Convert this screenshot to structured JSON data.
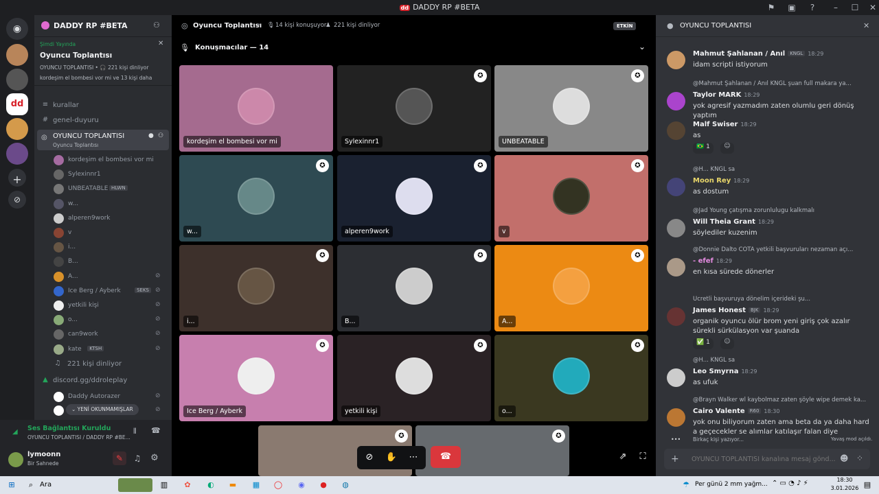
{
  "window": {
    "title": "DADDY RP #BETA"
  },
  "server": {
    "name": "DADDY RP #BETA"
  },
  "live_card": {
    "status": "Şimdi Yayında",
    "title": "Oyuncu Toplantısı",
    "sub": "OYUNCU TOPLANTISI • 🎧 221 kişi dinliyor",
    "people": "kordeşim el bombesi vor mi ve 13 kişi daha"
  },
  "channels": [
    {
      "icon": "≡",
      "label": "kurallar"
    },
    {
      "icon": "#",
      "label": "genel-duyuru"
    }
  ],
  "active_channel": {
    "label": "OYUNCU TOPLANTISI",
    "sub": "Oyuncu Toplantısı"
  },
  "members": [
    {
      "name": "kordeşim el bombesi vor mi",
      "color": "#a56ba1"
    },
    {
      "name": "Sylexinnr1",
      "color": "#666"
    },
    {
      "name": "UNBEATABLE",
      "badge": "HLWN",
      "color": "#777"
    },
    {
      "name": "w...",
      "color": "#556"
    },
    {
      "name": "alperen9work",
      "color": "#ccc"
    },
    {
      "name": "v",
      "color": "#843"
    },
    {
      "name": "i...",
      "color": "#654"
    },
    {
      "name": "B...",
      "color": "#444"
    },
    {
      "name": "A...",
      "color": "#d8912a",
      "muted": true
    },
    {
      "name": "Ice Berg / Ayberk",
      "badge": "SEKS",
      "color": "#36c",
      "muted": true
    },
    {
      "name": "yetkili kişi",
      "color": "#eee",
      "muted": true
    },
    {
      "name": "o...",
      "color": "#8a7",
      "muted": true
    },
    {
      "name": "can9work",
      "color": "#666",
      "muted": true
    },
    {
      "name": "kate",
      "badge": "KTSH",
      "color": "#9a8",
      "muted": true
    }
  ],
  "listening": "221 kişi dinliyor",
  "invite_channel": "discord.gg/ddroleplay",
  "bottom_members": [
    {
      "name": "Daddy Autorazer"
    },
    {
      "name": ""
    }
  ],
  "unread_pill": "YENİ OKUNMAMIŞLAR",
  "voice_status": {
    "title": "Ses Bağlantısı Kuruldu",
    "sub": "OYUNCU TOPLANTISI / DADDY RP #BE..."
  },
  "user": {
    "name": "lymoonn",
    "status": "Bir Sahnede"
  },
  "stage": {
    "title": "Oyuncu Toplantısı",
    "speaking": "14 kişi konuşuyor",
    "listening": "221 kişi dinliyor",
    "live_badge": "ETKİN",
    "speakers_header": "Konuşmacılar — 14"
  },
  "tiles": [
    {
      "label": "kordeşim el bombesi vor mi",
      "bg": "#a56b8f",
      "av": "#c8a"
    },
    {
      "label": "Sylexinnr1",
      "bg": "#222",
      "av": "#555"
    },
    {
      "label": "UNBEATABLE",
      "bg": "#888",
      "av": "#ddd"
    },
    {
      "label": "w...",
      "bg": "#2e4a52",
      "av": "#688"
    },
    {
      "label": "alperen9work",
      "bg": "#1a2130",
      "av": "#dde"
    },
    {
      "label": "v",
      "bg": "#c26f6b",
      "av": "#332"
    },
    {
      "label": "i...",
      "bg": "#3d302b",
      "av": "#654"
    },
    {
      "label": "B...",
      "bg": "#2c2e33",
      "av": "#ccc"
    },
    {
      "label": "A...",
      "bg": "#ec8a13",
      "av": "#f4a040"
    },
    {
      "label": "Ice Berg / Ayberk",
      "bg": "#c77fae",
      "av": "#eee"
    },
    {
      "label": "yetkili kişi",
      "bg": "#2a2225",
      "av": "#ddd"
    },
    {
      "label": "o...",
      "bg": "#3a3820",
      "av": "#2ab"
    }
  ],
  "chat": {
    "header": "OYUNCU TOPLANTISI",
    "messages": [
      {
        "name": "Mahmut Şahlanan / Anıl",
        "tag": "KNGL",
        "time": "18:29",
        "text": "idam scripti istiyorum",
        "color": "#f2f3f5",
        "av": "#c96"
      },
      {
        "reply": "@Mahmut Şahlanan / Anıl  KNGL  şuan full makara ya...",
        "name": "Taylor MARK",
        "time": "18:29",
        "text": "yok agresif yazmadım zaten olumlu geri dönüş yaptım",
        "color": "#f2f3f5",
        "av": "#a4c"
      },
      {
        "name": "Malf Swiser",
        "time": "18:29",
        "text": "as",
        "color": "#f2f3f5",
        "av": "#543",
        "react": "🇧🇷 1"
      },
      {
        "reply": "@H...  KNGL  sa",
        "name": "Moon Rey",
        "time": "18:29",
        "text": "as dostum",
        "color": "#e8d66a",
        "av": "#447"
      },
      {
        "reply": "@Jad Young çatışma zorunlulugu kalkmalı",
        "name": "Will Theia Grant",
        "time": "18:29",
        "text": "söylediler kuzenim",
        "color": "#f2f3f5",
        "av": "#888"
      },
      {
        "reply": "@Donnie Dalto  COTA  yetkili başvuruları nezaman açı...",
        "name": "- efef",
        "time": "18:29",
        "text": "en kısa sürede dönerler",
        "color": "#e38be0",
        "av": "#a98"
      },
      {
        "reply": "Ücretli başvuruya dönelim içerideki şu...",
        "name": "James Honest",
        "tag": "BJK",
        "time": "18:29",
        "text": "organik oyuncu ölür brom yeni giriş çok azalır sürekli sürkülasyon var şuanda",
        "color": "#f2f3f5",
        "av": "#633",
        "react": "✅ 1"
      },
      {
        "reply": "@H...  KNGL  sa",
        "name": "Leo Smyrna",
        "time": "18:29",
        "text": "as ufuk",
        "color": "#f2f3f5",
        "av": "#ccc"
      },
      {
        "reply": "@Brayn Walker wl kaybolmaz zaten şöyle wipe demek ka...",
        "name": "Cairo Valente",
        "tag": "R60",
        "time": "18:30",
        "text": "yok onu biliyorum zaten ama beta da ya daha hard a geçecekler se alımlar katılaşır falan diye",
        "color": "#f2f3f5",
        "av": "#b73"
      }
    ],
    "typing": "Birkaç kişi yazıyor...",
    "slowmode": "Yavaş mod açıldı.",
    "input_placeholder": "OYUNCU TOPLANTISI kanalına mesaj gönd..."
  },
  "taskbar": {
    "search": "Ara",
    "weather": "Per günü 2 mm yağm...",
    "time": "18:30",
    "date": "3.01.2026"
  }
}
